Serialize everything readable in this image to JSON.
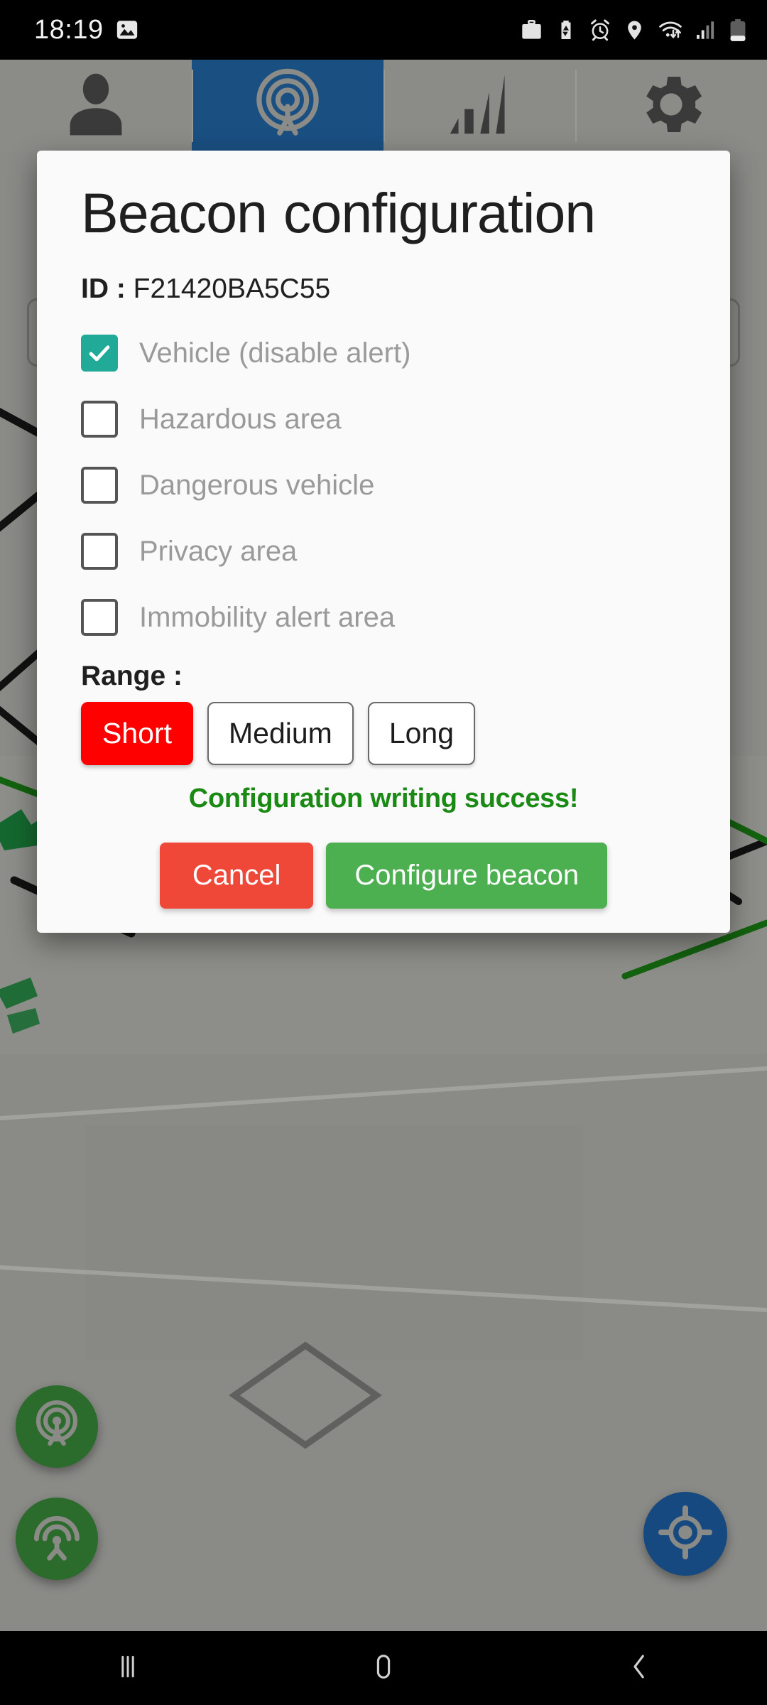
{
  "status_bar": {
    "time": "18:19",
    "left_icons": [
      {
        "name": "screenshot-icon"
      }
    ],
    "right_icons": [
      {
        "name": "work-profile-briefcase-icon"
      },
      {
        "name": "battery-saver-icon"
      },
      {
        "name": "alarm-icon"
      },
      {
        "name": "location-icon"
      },
      {
        "name": "wifi-icon"
      },
      {
        "name": "cellular-signal-icon"
      },
      {
        "name": "battery-icon"
      }
    ]
  },
  "tabs": [
    {
      "id": "profile",
      "icon": "person-icon",
      "selected": false
    },
    {
      "id": "beacons",
      "icon": "beacon-icon",
      "selected": true
    },
    {
      "id": "signal",
      "icon": "signal-bars-icon",
      "selected": false
    },
    {
      "id": "settings",
      "icon": "gear-icon",
      "selected": false
    }
  ],
  "search": {
    "value": "",
    "placeholder": ""
  },
  "dialog": {
    "title": "Beacon configuration",
    "id_label": "ID :",
    "id_value": "F21420BA5C55",
    "options": [
      {
        "label": "Vehicle (disable alert)",
        "checked": true
      },
      {
        "label": "Hazardous area",
        "checked": false
      },
      {
        "label": "Dangerous vehicle",
        "checked": false
      },
      {
        "label": "Privacy area",
        "checked": false
      },
      {
        "label": "Immobility alert area",
        "checked": false
      }
    ],
    "range_label": "Range :",
    "range_options": [
      {
        "label": "Short",
        "selected": true
      },
      {
        "label": "Medium",
        "selected": false
      },
      {
        "label": "Long",
        "selected": false
      }
    ],
    "status_message": "Configuration writing success!",
    "cancel_label": "Cancel",
    "confirm_label": "Configure beacon"
  },
  "fabs": [
    {
      "name": "beacon-scan-fab",
      "icon": "beacon-icon"
    },
    {
      "name": "beacon-emit-fab",
      "icon": "broadcast-tower-icon"
    },
    {
      "name": "my-location-fab",
      "icon": "my-location-icon"
    }
  ],
  "nav_bar": [
    {
      "name": "recents-button",
      "icon": "recents-icon"
    },
    {
      "name": "home-button",
      "icon": "home-icon"
    },
    {
      "name": "back-button",
      "icon": "back-icon"
    }
  ],
  "colors": {
    "accent_blue": "#1a4f82",
    "checkbox_teal": "#22aa99",
    "range_selected_red": "#FF0000",
    "cancel_red": "#ef4738",
    "confirm_green": "#4caf50",
    "success_green": "#1a8a14",
    "fab_green": "#2b6b2b",
    "fab_blue": "#16497f",
    "map_dim": "#8a8a87"
  }
}
